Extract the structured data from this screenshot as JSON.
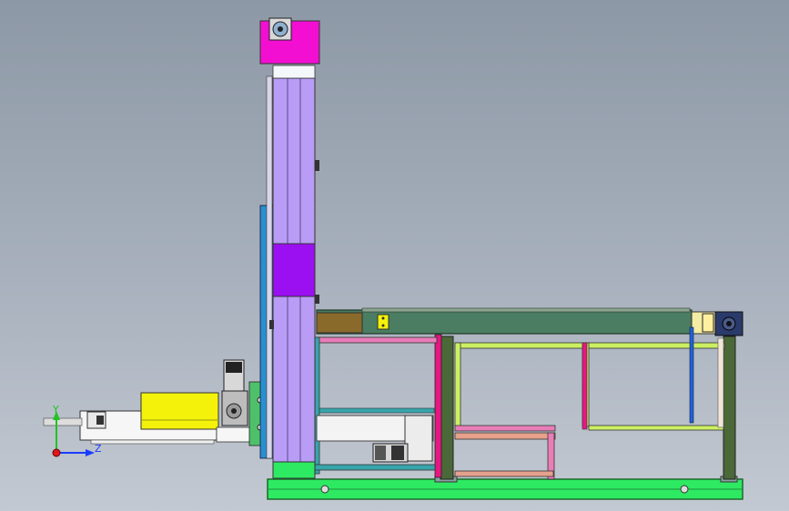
{
  "triad": {
    "y_label": "Y",
    "z_label": "Z",
    "colors": {
      "y": "#22c322",
      "z": "#1a3cff",
      "x": "#e01818"
    }
  },
  "colors": {
    "background_top": "#8d98a6",
    "background_bottom": "#c3c9d2",
    "column": "#b89cf5",
    "carriage": "#9b10f0",
    "top_motor_housing": "#f20fd2",
    "hopper": "#f4f20a",
    "base_frame": "#2eea62",
    "conveyor_body": "#4a7d62",
    "frame_green": "#4b6838",
    "frame_yellow_green": "#ccf063",
    "frame_pink": "#e97db8",
    "frame_magenta": "#e81583",
    "frame_teal": "#37a5aa",
    "frame_salmon": "#e6a08c",
    "end_drive": "#2a3a6a",
    "blue_rod": "#2060e0"
  }
}
